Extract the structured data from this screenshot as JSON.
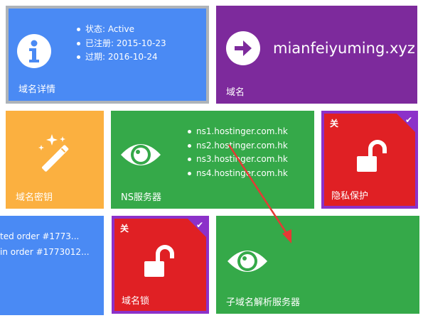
{
  "domain_details": {
    "label": "域名详情",
    "items": [
      "状态: Active",
      "已注册: 2015-10-23",
      "过期: 2016-10-24"
    ],
    "icon": "info-icon"
  },
  "domain_name": {
    "label": "域名",
    "value": "mianfeiyuming.xyz",
    "icon": "arrow-right-icon"
  },
  "domain_key": {
    "label": "域名密钥",
    "icon": "magic-wand-icon"
  },
  "ns_servers": {
    "label": "NS服务器",
    "items": [
      "ns1.hostinger.com.hk",
      "ns2.hostinger.com.hk",
      "ns3.hostinger.com.hk",
      "ns4.hostinger.com.hk"
    ],
    "icon": "eye-icon"
  },
  "privacy": {
    "label": "隐私保护",
    "toggle": "关",
    "icon": "unlock-icon"
  },
  "orders": {
    "lines": [
      "ted order #1773...",
      "in order #1773012..."
    ]
  },
  "domain_lock": {
    "label": "域名锁",
    "toggle": "关",
    "icon": "unlock-icon"
  },
  "subdomain": {
    "label": "子域名解析服务器",
    "icon": "eye-icon"
  },
  "colors": {
    "blue": "#4a8af4",
    "purple": "#7d2a9c",
    "orange": "#fbb040",
    "green": "#35a949",
    "red": "#e02024",
    "accent": "#8c31c9",
    "arrow": "#e53935"
  }
}
